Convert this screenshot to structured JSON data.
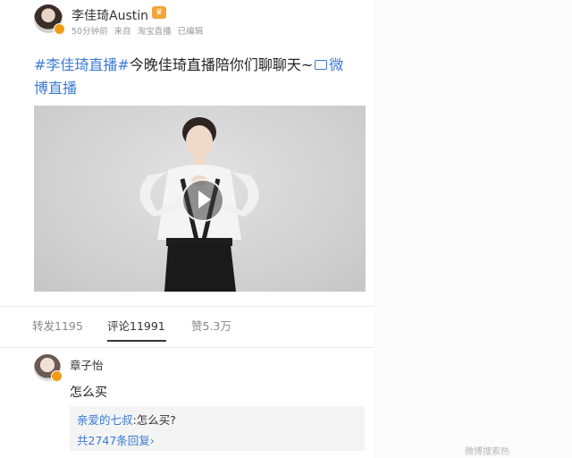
{
  "post": {
    "username": "李佳琦Austin",
    "time": "50分钟前",
    "source_prefix": "来自",
    "source": "淘宝直播",
    "edited": "已编辑",
    "tag1": "#李佳琦直播#",
    "text": "今晚佳琦直播陪你们聊聊天~",
    "link": "微博直播"
  },
  "stats": {
    "repost": "转发1195",
    "comment": "评论11991",
    "like": "赞5.3万"
  },
  "comment": {
    "name": "章子怡",
    "text": "怎么买",
    "reply_user": "亲爱的七叔",
    "reply_text": ":怎么买?",
    "reply_count": "共2747条回复",
    "reply_chevron": "›"
  },
  "watermark": "微博搜索热"
}
